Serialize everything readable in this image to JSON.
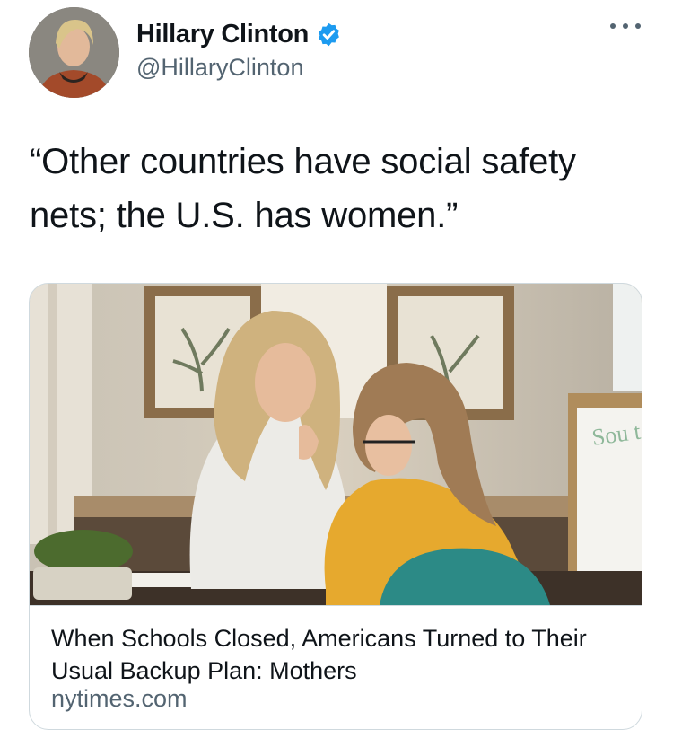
{
  "author": {
    "name": "Hillary Clinton",
    "handle": "@HillaryClinton",
    "verified": true
  },
  "tweet": {
    "text": "“Other countries have social safety nets; the U.S. has women.”"
  },
  "link_card": {
    "title": "When Schools Closed, Americans Turned to Their Usual Backup Plan: Mothers",
    "domain": "nytimes.com",
    "image_handwriting": "Sou t ed"
  },
  "icons": {
    "verified": "verified-badge-icon",
    "more": "more-options-icon"
  },
  "colors": {
    "text": "#0f1419",
    "secondary": "#536471",
    "verified": "#1d9bf0",
    "border": "#cfd9de"
  }
}
